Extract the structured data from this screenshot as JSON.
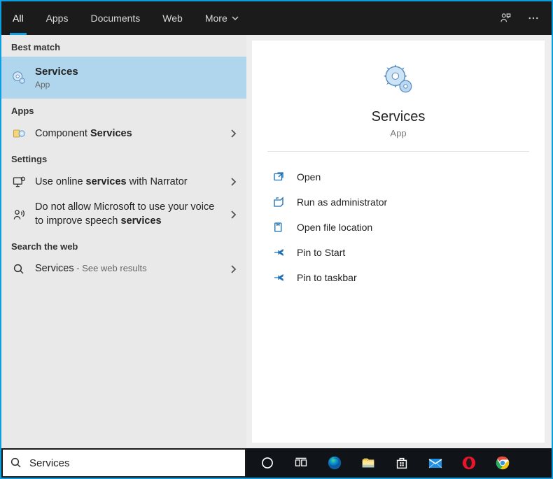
{
  "tabs": {
    "all": "All",
    "apps": "Apps",
    "documents": "Documents",
    "web": "Web",
    "more": "More"
  },
  "sections": {
    "best_match": "Best match",
    "apps": "Apps",
    "settings": "Settings",
    "search_web": "Search the web"
  },
  "best": {
    "title": "Services",
    "subtitle": "App"
  },
  "apps_results": {
    "component_pre": "Component ",
    "component_bold": "Services"
  },
  "settings_results": {
    "narrator_pre": "Use online ",
    "narrator_bold": "services",
    "narrator_post": " with Narrator",
    "voice_pre": "Do not allow Microsoft to use your voice to improve speech ",
    "voice_bold": "services"
  },
  "web_results": {
    "services_label": "Services",
    "services_suffix": " - See web results"
  },
  "detail": {
    "title": "Services",
    "subtitle": "App",
    "actions": {
      "open": "Open",
      "run_admin": "Run as administrator",
      "open_loc": "Open file location",
      "pin_start": "Pin to Start",
      "pin_taskbar": "Pin to taskbar"
    }
  },
  "search": {
    "value": "Services"
  }
}
